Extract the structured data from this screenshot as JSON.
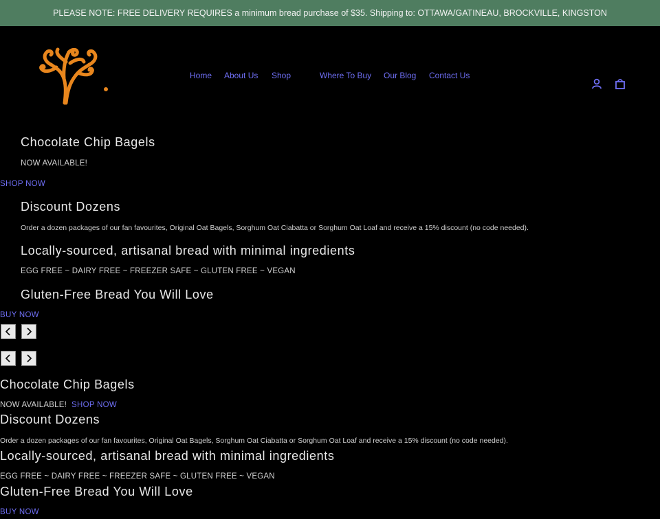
{
  "announcement": "PLEASE NOTE: FREE DELIVERY REQUIRES a minimum bread purchase of $35. Shipping to: OTTAWA/GATINEAU, BROCKVILLE, KINGSTON",
  "nav": {
    "home": "Home",
    "about": "About Us",
    "shop": "Shop",
    "where": "Where To Buy",
    "blog": "Our Blog",
    "contact": "Contact Us"
  },
  "icons": {
    "account": "user-icon",
    "cart": "bag-icon",
    "prev": "chevron-left-icon",
    "next": "chevron-right-icon",
    "logo": "tree-logo"
  },
  "colors": {
    "announce_bg": "#4f7d60",
    "link": "#6f6ff5",
    "logo": "#e8861d",
    "page_bg": "#000000"
  },
  "slides": [
    {
      "heading": "Chocolate Chip Bagels",
      "sub": "NOW AVAILABLE!",
      "button": "SHOP NOW"
    },
    {
      "heading": "Discount Dozens",
      "sub": "Order a dozen packages of our fan favourites, Original Oat Bagels, Sorghum Oat Ciabatta or Sorghum Oat Loaf and receive a 15% discount (no code needed)."
    },
    {
      "heading": "Locally-sourced, artisanal bread with minimal ingredients",
      "sub": "EGG FREE ~ DAIRY FREE ~ FREEZER SAFE ~ GLUTEN FREE ~ VEGAN"
    },
    {
      "heading": "Gluten-Free Bread You Will Love",
      "button": "BUY NOW"
    }
  ]
}
